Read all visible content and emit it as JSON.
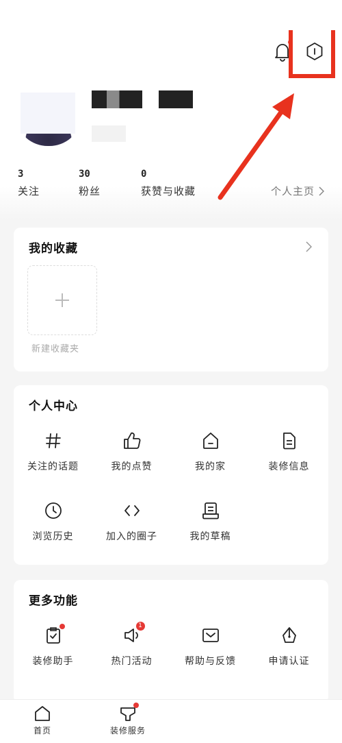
{
  "header": {
    "bell_icon": "bell-icon",
    "settings_icon": "settings-hexagon-icon",
    "annotation_color": "#e8321e"
  },
  "profile": {
    "stats": [
      {
        "count": "3",
        "label": "关注"
      },
      {
        "count": "30",
        "label": "粉丝"
      },
      {
        "count": "0",
        "label": "获赞与收藏"
      }
    ],
    "homepage_link": "个人主页"
  },
  "favorites": {
    "title": "我的收藏",
    "new_folder_label": "新建收藏夹"
  },
  "personal_center": {
    "title": "个人中心",
    "items": [
      {
        "label": "关注的话题",
        "icon": "hashtag-icon"
      },
      {
        "label": "我的点赞",
        "icon": "thumbs-up-icon"
      },
      {
        "label": "我的家",
        "icon": "home-icon"
      },
      {
        "label": "装修信息",
        "icon": "document-icon"
      },
      {
        "label": "浏览历史",
        "icon": "clock-icon"
      },
      {
        "label": "加入的圈子",
        "icon": "code-brackets-icon"
      },
      {
        "label": "我的草稿",
        "icon": "draft-icon"
      }
    ]
  },
  "more_functions": {
    "title": "更多功能",
    "items": [
      {
        "label": "装修助手",
        "icon": "clipboard-check-icon"
      },
      {
        "label": "热门活动",
        "icon": "megaphone-icon",
        "badge": "1"
      },
      {
        "label": "帮助与反馈",
        "icon": "mail-icon"
      },
      {
        "label": "申请认证",
        "icon": "pen-nib-icon"
      }
    ]
  },
  "tabbar": {
    "items": [
      {
        "label": "首页",
        "icon": "home-tab-icon"
      },
      {
        "label": "装修服务",
        "icon": "service-icon"
      }
    ]
  }
}
